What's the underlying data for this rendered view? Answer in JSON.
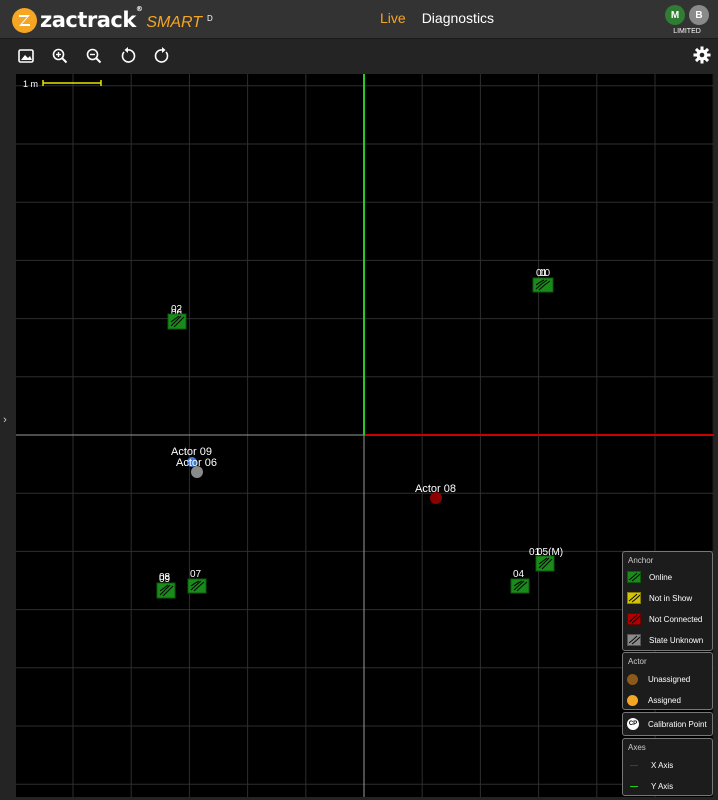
{
  "header": {
    "brand": "zactrack",
    "brand_reg": "®",
    "brand_product": "SMART",
    "brand_edition": "D",
    "nav": [
      {
        "label": "Live",
        "active": true
      },
      {
        "label": "Diagnostics",
        "active": false
      }
    ],
    "user": {
      "initials_1": "M",
      "initials_2": "B",
      "status": "LIMITED"
    }
  },
  "toolbar": {
    "tools": [
      "image-icon",
      "zoom-in-icon",
      "zoom-out-icon",
      "rotate-left-icon",
      "rotate-right-icon"
    ],
    "settings": "gear-icon"
  },
  "map": {
    "scale_label": "1 m",
    "anchors": [
      {
        "label": "02",
        "state": "online"
      },
      {
        "label": "06",
        "state": "online"
      },
      {
        "label": "01",
        "state": "online"
      },
      {
        "label": "10",
        "state": "online"
      },
      {
        "label": "08",
        "state": "online"
      },
      {
        "label": "09",
        "state": "online"
      },
      {
        "label": "07",
        "state": "online"
      },
      {
        "label": "04",
        "state": "online"
      },
      {
        "label": "01",
        "state": "online"
      },
      {
        "label": "05(M)",
        "state": "online"
      }
    ],
    "actors": [
      {
        "label": "Actor 09",
        "color": "#3a7bd5"
      },
      {
        "label": "Actor 06",
        "color": "#8a8a8a"
      },
      {
        "label": "Actor 08",
        "color": "#8b0000"
      }
    ],
    "axes": {
      "x_color": "#cc0000",
      "y_color": "#22cc22"
    }
  },
  "legend": {
    "anchor_title": "Anchor",
    "anchor_items": [
      {
        "label": "Online",
        "color": "#1a8a1a"
      },
      {
        "label": "Not in Show",
        "color": "#d4c400"
      },
      {
        "label": "Not Connected",
        "color": "#b00000"
      },
      {
        "label": "State Unknown",
        "color": "#8a8a8a"
      }
    ],
    "actor_title": "Actor",
    "actor_items": [
      {
        "label": "Unassigned",
        "color": "#8b5a1a"
      },
      {
        "label": "Assigned",
        "color": "#f5a623"
      }
    ],
    "calibration": {
      "badge": "CP",
      "label": "Calibration Point"
    },
    "axes_title": "Axes",
    "axes_items": [
      {
        "label": "X Axis",
        "color": "#cc0000"
      },
      {
        "label": "Y Axis",
        "color": "#22cc22"
      }
    ]
  }
}
